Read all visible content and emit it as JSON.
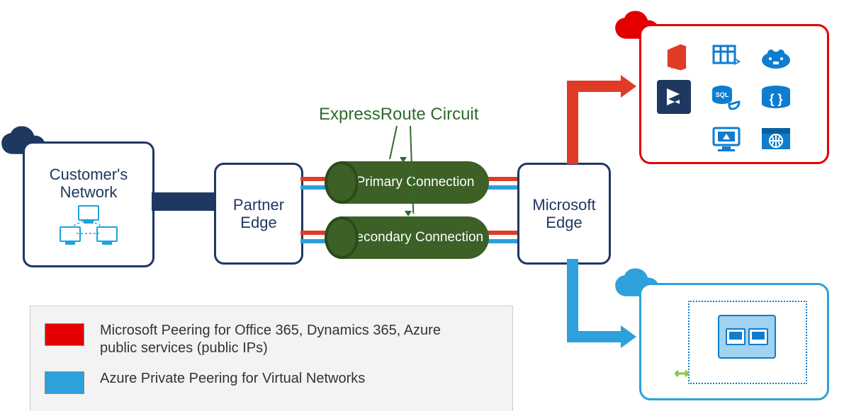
{
  "labels": {
    "customer": "Customer's\nNetwork",
    "partner": "Partner\nEdge",
    "msedge": "Microsoft\nEdge",
    "ertitle": "ExpressRoute Circuit",
    "primary": "Primary Connection",
    "secondary": "Secondary Connection"
  },
  "legend": {
    "msPeering": "Microsoft Peering for Office 365, Dynamics 365, Azure public services (public IPs)",
    "privatePeering": "Azure Private Peering for Virtual Networks"
  },
  "colors": {
    "navy": "#1e3860",
    "green": "#3c6026",
    "red": "#e40000",
    "orange": "#e03b26",
    "blue": "#2ea0db",
    "azure": "#0e7dd0"
  },
  "services_top": [
    "office-365",
    "azure-table",
    "hdinsight",
    "dynamics-365",
    "sql-database",
    "code-braces",
    "",
    "vm-monitor",
    "website"
  ],
  "vnet": {
    "peering_icon": "vnet-peering"
  }
}
